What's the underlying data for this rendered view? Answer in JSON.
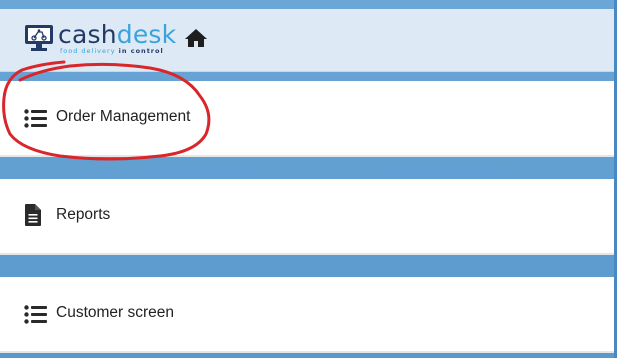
{
  "header": {
    "brand_part1": "cash",
    "brand_part2": "desk",
    "tagline_part1": "food delivery",
    "tagline_part2": "in control",
    "icons": [
      "monitor-scooter-logo-icon",
      "home-icon"
    ]
  },
  "menu": {
    "items": [
      {
        "label": "Order Management",
        "icon": "list-icon",
        "highlighted": true
      },
      {
        "label": "Reports",
        "icon": "document-icon"
      },
      {
        "label": "Customer screen",
        "icon": "list-icon"
      }
    ]
  },
  "colors": {
    "background": "#5a98cd",
    "header": "#dde9f5",
    "brand_dark": "#243a66",
    "brand_light": "#3aa3dc",
    "annotation": "#d9262b"
  }
}
